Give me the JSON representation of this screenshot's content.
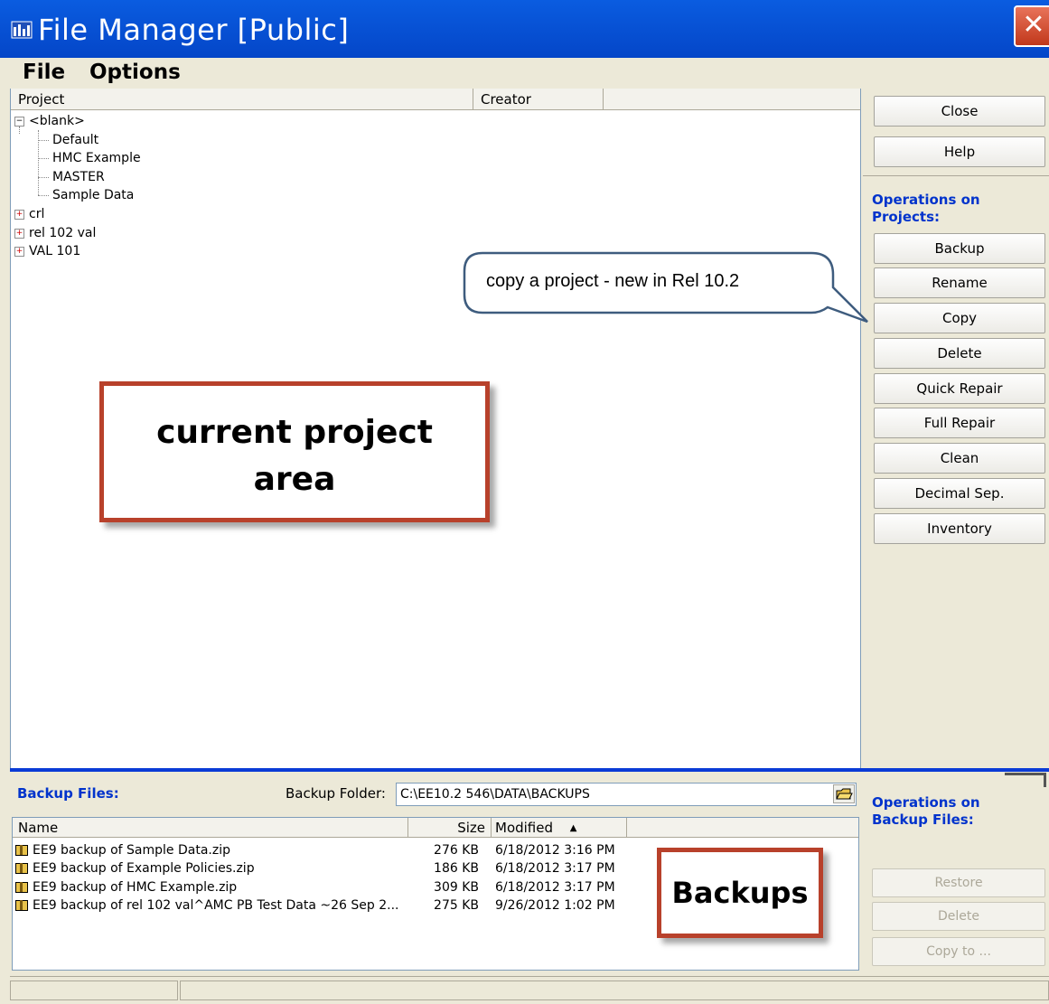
{
  "window": {
    "title": "File Manager [Public]",
    "app_icon": "file-manager-icon",
    "close_icon": "close-x-icon"
  },
  "menu": {
    "file": "File",
    "options": "Options"
  },
  "project_panel": {
    "col_project": "Project",
    "col_creator": "Creator",
    "tree": {
      "root_blank": "<blank>",
      "default": "Default",
      "hmc_example": "HMC Example",
      "master": "MASTER",
      "sample_data": "Sample Data",
      "crl": "crl",
      "rel_102_val": "rel 102 val",
      "val_101": "VAL 101"
    }
  },
  "right_panel": {
    "close": "Close",
    "help": "Help",
    "ops_projects_line1": "Operations on",
    "ops_projects_line2": "Projects:",
    "backup": "Backup",
    "rename": "Rename",
    "copy": "Copy",
    "delete": "Delete",
    "quick_repair": "Quick Repair",
    "full_repair": "Full Repair",
    "clean": "Clean",
    "decimal_sep": "Decimal Sep.",
    "inventory": "Inventory",
    "ops_backup_line1": "Operations on",
    "ops_backup_line2": "Backup Files:",
    "restore": "Restore",
    "backup_delete": "Delete",
    "copy_to": "Copy to ..."
  },
  "backup": {
    "files_label": "Backup Files:",
    "folder_label": "Backup Folder:",
    "folder_value": "C:\\EE10.2 546\\DATA\\BACKUPS",
    "col_name": "Name",
    "col_size": "Size",
    "col_modified": "Modified",
    "sort_indicator": "▲",
    "files": [
      {
        "name": "EE9 backup of Sample Data.zip",
        "size": "276 KB",
        "modified": "6/18/2012 3:16 PM"
      },
      {
        "name": "EE9 backup of Example Policies.zip",
        "size": "186 KB",
        "modified": "6/18/2012 3:17 PM"
      },
      {
        "name": "EE9 backup of HMC Example.zip",
        "size": "309 KB",
        "modified": "6/18/2012 3:17 PM"
      },
      {
        "name": "EE9 backup of rel 102 val^AMC PB Test Data ~26 Sep 2...",
        "size": "275 KB",
        "modified": "9/26/2012 1:02 PM"
      }
    ]
  },
  "annotations": {
    "speech_bubble": "copy a project - new in Rel 10.2",
    "current_project_line1": "current project",
    "current_project_line2": "area",
    "backups": "Backups"
  },
  "colors": {
    "titlebar": "#0A5CE0",
    "ops_label": "#0033CC",
    "callout_border": "#B8412B",
    "bubble_border": "#3E5C7E"
  }
}
